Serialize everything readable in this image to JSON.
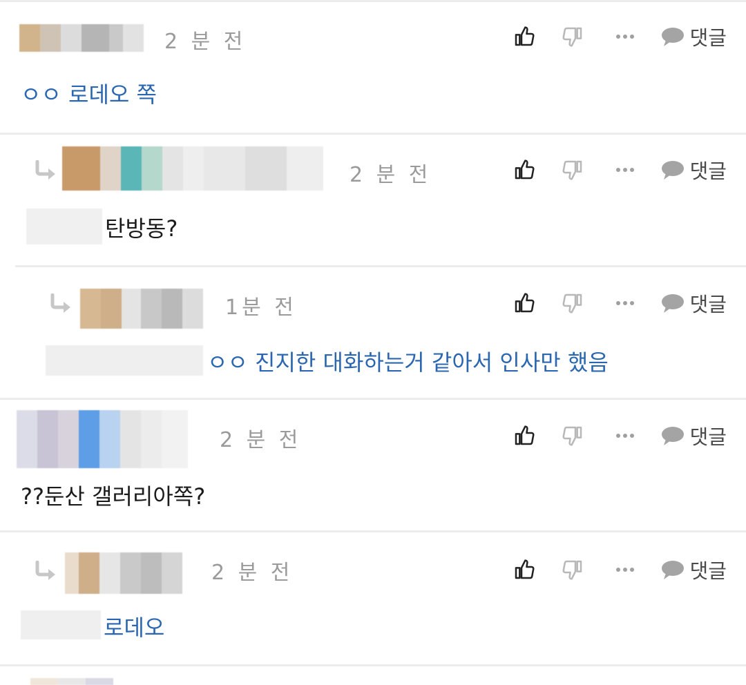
{
  "comments": [
    {
      "time": "2 분 전",
      "body": "ㅇㅇ 로데오 쪽",
      "reply_label": "댓글"
    },
    {
      "time": "2 분 전",
      "body": "탄방동?",
      "reply_label": "댓글"
    },
    {
      "time": "1분 전",
      "body": "ㅇㅇ 진지한 대화하는거 같아서 인사만 했음",
      "reply_label": "댓글"
    },
    {
      "time": "2 분 전",
      "body": "??둔산 갤러리아쪽?",
      "reply_label": "댓글"
    },
    {
      "time": "2 분 전",
      "body": "로데오",
      "reply_label": "댓글"
    }
  ],
  "colors": {
    "mention": "#2a67b0",
    "text": "#1b1b1b",
    "meta": "#9a9a9a",
    "divider": "#ececec"
  },
  "icons": {
    "like": "thumbs-up-icon",
    "dislike": "thumbs-down-icon",
    "more": "more-dots-icon",
    "reply": "speech-bubble-icon",
    "reply_arrow": "reply-arrow-icon"
  }
}
